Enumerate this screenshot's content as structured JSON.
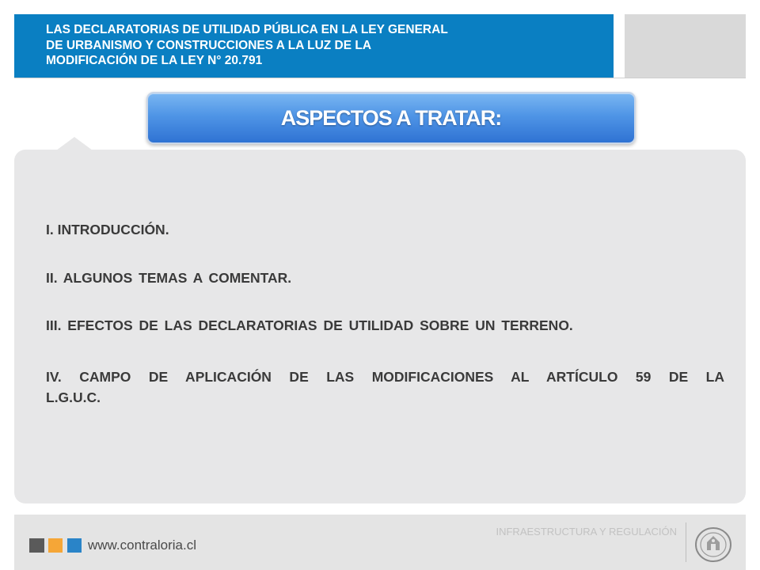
{
  "header": {
    "title": "LAS DECLARATORIAS DE UTILIDAD PÚBLICA EN LA LEY GENERAL\nDE URBANISMO Y CONSTRUCCIONES A LA LUZ DE LA\nMODIFICACIÓN DE LA LEY N° 20.791",
    "accent_color": "#0a7fc2"
  },
  "section": {
    "heading": "ASPECTOS A TRATAR:"
  },
  "agenda": {
    "items": [
      "I. INTRODUCCIÓN.",
      "II. ALGUNOS TEMAS A COMENTAR.",
      "III. EFECTOS DE LAS DECLARATORIAS DE UTILIDAD SOBRE UN TERRENO.",
      "IV. CAMPO DE APLICACIÓN DE LAS MODIFICACIONES AL ARTÍCULO 59 DE LA L.G.U.C."
    ],
    "item4_line1": "IV. CAMPO DE APLICACIÓN DE LAS MODIFICACIONES AL ARTÍCULO 59 DE LA",
    "item4_line2": "L.G.U.C."
  },
  "footer": {
    "url": "www.contraloria.cl",
    "caption": "INFRAESTRUCTURA Y REGULACIÓN",
    "logo": "contraloria-seal-icon",
    "square_colors": [
      "#5a5a5a",
      "#f5a637",
      "#2a84c8"
    ]
  }
}
